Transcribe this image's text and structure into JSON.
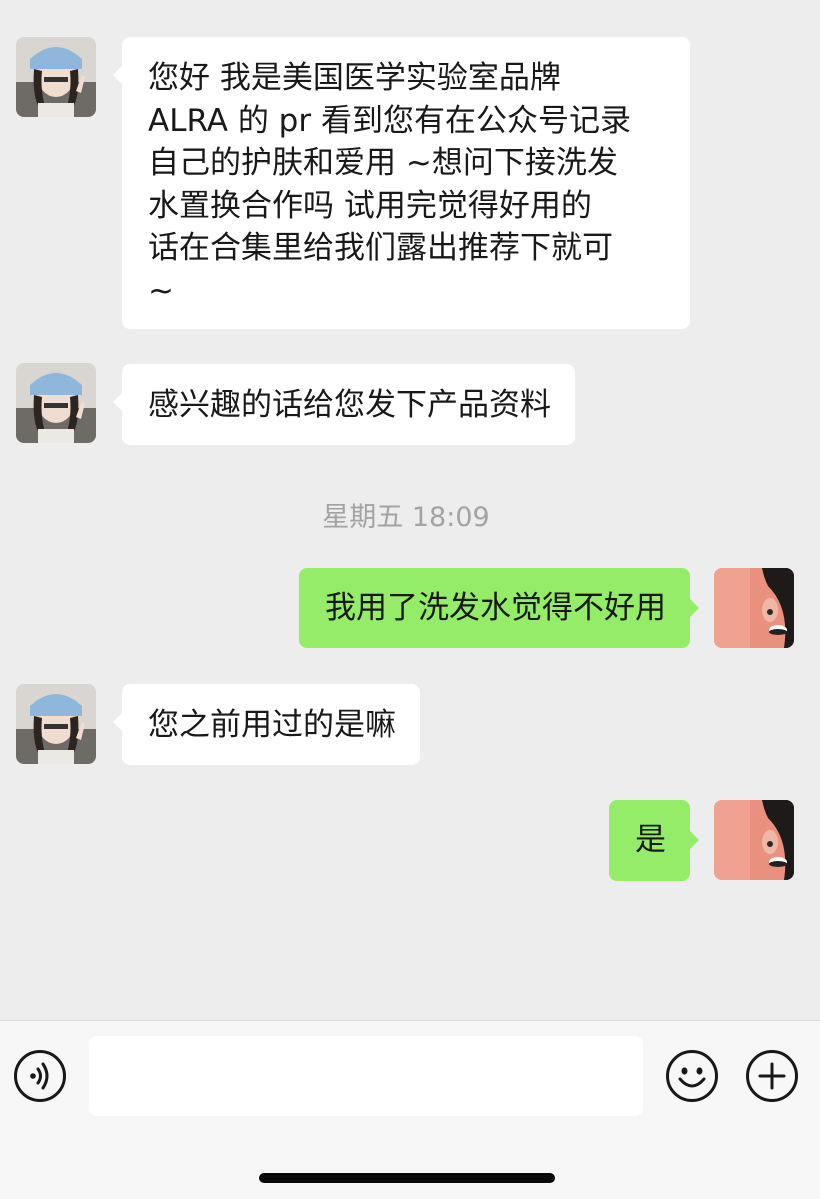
{
  "messages": [
    {
      "direction": "incoming",
      "avatar": "contact-avatar",
      "lines": [
        "您好 我是美国医学实验室品牌",
        "ALRA 的 pr 看到您有在公众号记录",
        "自己的护肤和爱用 ~想问下接洗发",
        "水置换合作吗 试用完觉得好用的",
        "话在合集里给我们露出推荐下就可",
        "~"
      ]
    },
    {
      "direction": "incoming",
      "avatar": "contact-avatar",
      "text": "感兴趣的话给您发下产品资料"
    },
    {
      "direction": "outgoing",
      "avatar": "self-avatar",
      "text": "我用了洗发水觉得不好用"
    },
    {
      "direction": "incoming",
      "avatar": "contact-avatar",
      "text": "您之前用过的是嘛"
    },
    {
      "direction": "outgoing",
      "avatar": "self-avatar",
      "text": "是"
    }
  ],
  "timestamp": "星期五 18:09",
  "input_bar": {
    "message_value": "",
    "voice_icon": "voice-icon",
    "emoji_icon": "emoji-icon",
    "plus_icon": "plus-icon"
  },
  "colors": {
    "background": "#ededed",
    "incoming_bubble": "#ffffff",
    "outgoing_bubble": "#95ec69",
    "timestamp_text": "#a3a3a3",
    "input_bar": "#f7f7f7"
  }
}
